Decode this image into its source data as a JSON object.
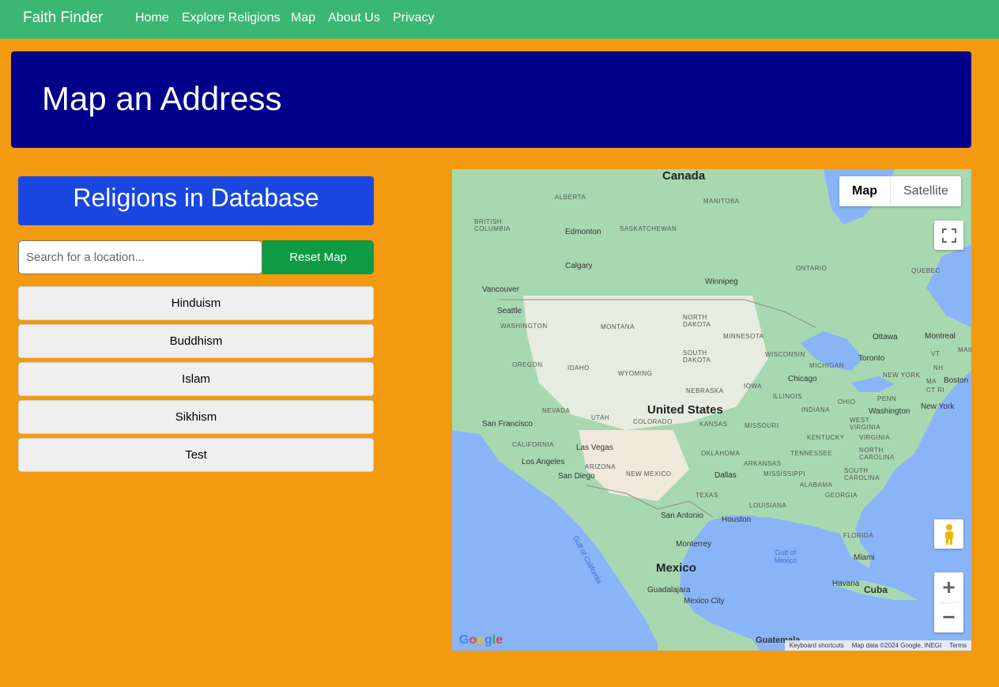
{
  "nav": {
    "brand": "Faith Finder",
    "links": [
      "Home",
      "Explore Religions",
      "Map",
      "About Us",
      "Privacy"
    ]
  },
  "hero": {
    "title": "Map an Address"
  },
  "sidebar": {
    "header": "Religions in Database",
    "search_placeholder": "Search for a location...",
    "reset_label": "Reset Map",
    "religions": [
      "Hinduism",
      "Buddhism",
      "Islam",
      "Sikhism",
      "Test"
    ]
  },
  "map": {
    "type_map": "Map",
    "type_satellite": "Satellite",
    "labels": {
      "canada": "Canada",
      "alberta": "ALBERTA",
      "manitoba": "MANITOBA",
      "british_columbia": "BRITISH COLUMBIA",
      "edmonton": "Edmonton",
      "saskatchewan": "SASKATCHEWAN",
      "ontario": "ONTARIO",
      "quebec": "QUEBEC",
      "calgary": "Calgary",
      "winnipeg": "Winnipeg",
      "vancouver": "Vancouver",
      "seattle": "Seattle",
      "washington": "WASHINGTON",
      "montana": "MONTANA",
      "north_dakota": "NORTH DAKOTA",
      "minnesota": "MINNESOTA",
      "ottawa": "Ottawa",
      "montreal": "Montreal",
      "maine": "MAINE",
      "oregon": "OREGON",
      "idaho": "IDAHO",
      "south_dakota": "SOUTH DAKOTA",
      "wisconsin": "WISCONSIN",
      "michigan": "MICHIGAN",
      "toronto": "Toronto",
      "vt": "VT",
      "nh": "NH",
      "new_york_state": "NEW YORK",
      "ma": "MA",
      "ct_ri": "CT RI",
      "boston": "Boston",
      "wyoming": "WYOMING",
      "iowa": "IOWA",
      "chicago": "Chicago",
      "nebraska": "NEBRASKA",
      "illinois": "ILLINOIS",
      "penn": "PENN",
      "nevada": "NEVADA",
      "utah": "UTAH",
      "united_states": "United States",
      "indiana": "INDIANA",
      "ohio": "OHIO",
      "washington_dc": "Washington",
      "new_york": "New York",
      "san_francisco": "San Francisco",
      "colorado": "COLORADO",
      "kansas": "KANSAS",
      "missouri": "MISSOURI",
      "west_virginia": "WEST VIRGINIA",
      "kentucky": "KENTUCKY",
      "virginia": "VIRGINIA",
      "california": "CALIFORNIA",
      "las_vegas": "Las Vegas",
      "oklahoma": "OKLAHOMA",
      "tennessee": "TENNESSEE",
      "north_carolina": "NORTH CAROLINA",
      "los_angeles": "Los Angeles",
      "arizona": "ARIZONA",
      "arkansas": "ARKANSAS",
      "san_diego": "San Diego",
      "new_mexico": "NEW MEXICO",
      "dallas": "Dallas",
      "mississippi": "MISSISSIPPI",
      "south_carolina": "SOUTH CAROLINA",
      "alabama": "ALABAMA",
      "texas": "TEXAS",
      "georgia": "GEORGIA",
      "louisiana": "LOUISIANA",
      "gulf_of_california": "Gulf of California",
      "san_antonio": "San Antonio",
      "houston": "Houston",
      "florida": "FLORIDA",
      "monterrey": "Monterrey",
      "gulf_of_mexico": "Gulf of Mexico",
      "miami": "Miami",
      "mexico": "Mexico",
      "havana": "Havana",
      "cuba": "Cuba",
      "guadalajara": "Guadalajara",
      "mexico_city": "Mexico City",
      "guatemala": "Guatemala"
    },
    "google": "Google",
    "keyboard_shortcuts": "Keyboard shortcuts",
    "map_data": "Map data ©2024 Google, INEGI",
    "terms": "Terms"
  }
}
